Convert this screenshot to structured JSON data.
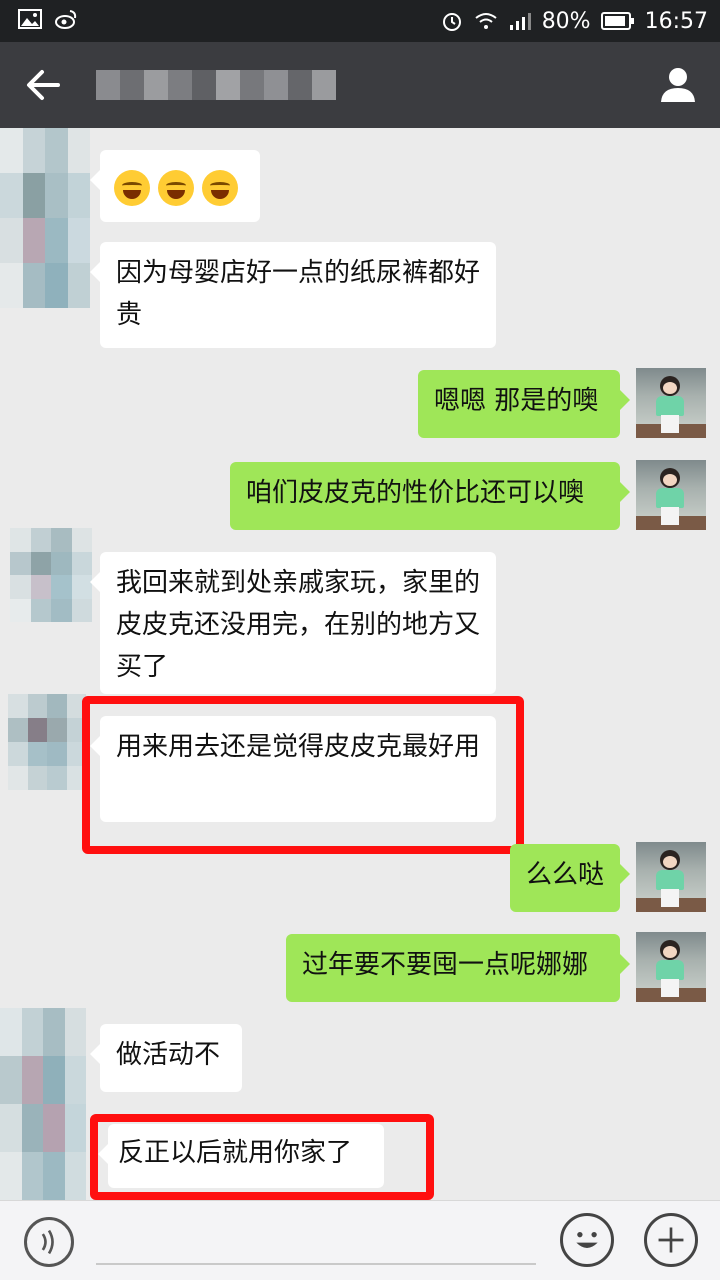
{
  "status_bar": {
    "battery": "80%",
    "time": "16:57",
    "icons": [
      "image-icon",
      "weibo-icon",
      "alarm-icon",
      "wifi-icon",
      "signal-icon",
      "battery-icon"
    ]
  },
  "header": {
    "back_icon": "arrow-left-icon",
    "contact_icon": "person-icon"
  },
  "messages": [
    {
      "side": "left",
      "text": ""
    },
    {
      "side": "left",
      "text": "因为母婴店好一点的纸尿裤都好贵"
    },
    {
      "side": "right",
      "text": "嗯嗯 那是的噢"
    },
    {
      "side": "right",
      "text": "咱们皮皮克的性价比还可以噢"
    },
    {
      "side": "left",
      "text": "我回来就到处亲戚家玩，家里的皮皮克还没用完，在别的地方又买了"
    },
    {
      "side": "left",
      "text": "用来用去还是觉得皮皮克最好用",
      "highlighted": true
    },
    {
      "side": "right",
      "text": "么么哒"
    },
    {
      "side": "right",
      "text": "过年要不要囤一点呢娜娜"
    },
    {
      "side": "left",
      "text": "做活动不"
    },
    {
      "side": "left",
      "text": "反正以后就用你家了",
      "highlighted": true
    }
  ],
  "emoji_message": {
    "count": 3,
    "icon": "tears-of-joy-icon"
  },
  "colors": {
    "self_bubble": "#9fe658",
    "other_bubble": "#ffffff",
    "highlight": "#ff0f0f",
    "topbar": "#3b3c40",
    "statusbar": "#1f2123",
    "background": "#ebebeb"
  },
  "input_bar": {
    "voice_icon": "voice-icon",
    "emoji_icon": "smiley-icon",
    "plus_icon": "plus-icon"
  }
}
